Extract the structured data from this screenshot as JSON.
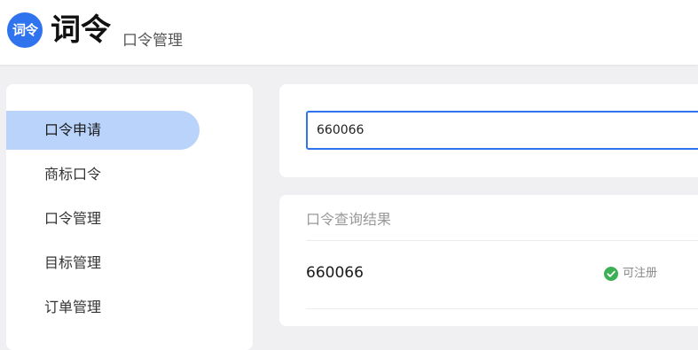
{
  "header": {
    "logo_text": "词令",
    "brand_name": "词令",
    "page_subtitle": "口令管理"
  },
  "sidebar": {
    "items": [
      {
        "label": "口令申请",
        "active": true
      },
      {
        "label": "商标口令",
        "active": false
      },
      {
        "label": "口令管理",
        "active": false
      },
      {
        "label": "目标管理",
        "active": false
      },
      {
        "label": "订单管理",
        "active": false
      }
    ]
  },
  "search": {
    "value": "660066"
  },
  "results": {
    "title": "口令查询结果",
    "items": [
      {
        "code": "660066",
        "status": "可注册",
        "status_icon": "check-circle-icon"
      }
    ]
  },
  "colors": {
    "accent": "#2f73ef",
    "active_nav_bg": "#b9d3fb",
    "status_ok": "#3bb055"
  }
}
